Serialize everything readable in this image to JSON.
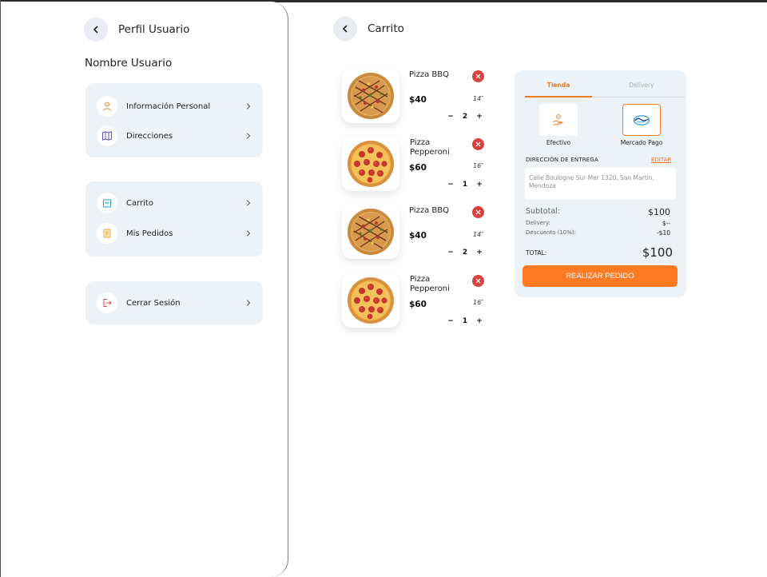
{
  "profile": {
    "title": "Perfil Usuario",
    "user_name": "Nombre Usuario",
    "group1": [
      {
        "label": "Información Personal",
        "icon": "user-icon"
      },
      {
        "label": "Direcciones",
        "icon": "map-icon"
      }
    ],
    "group2": [
      {
        "label": "Carrito",
        "icon": "shopping-bag-icon"
      },
      {
        "label": "Mis Pedidos",
        "icon": "orders-icon"
      }
    ],
    "group3": [
      {
        "label": "Cerrar Sesión",
        "icon": "logout-icon"
      }
    ]
  },
  "cart": {
    "title": "Carrito",
    "items": [
      {
        "name": "Pizza BBQ",
        "price": "$40",
        "size": "14″",
        "qty": "2",
        "image": "pizza-bbq"
      },
      {
        "name": "Pizza Pepperoni",
        "price": "$60",
        "size": "16″",
        "qty": "1",
        "image": "pizza-pepperoni"
      },
      {
        "name": "Pizza BBQ",
        "price": "$40",
        "size": "14″",
        "qty": "2",
        "image": "pizza-bbq"
      },
      {
        "name": "Pizza Pepperoni",
        "price": "$60",
        "size": "16″",
        "qty": "1",
        "image": "pizza-pepperoni"
      }
    ],
    "minus": "−",
    "plus": "+"
  },
  "summary": {
    "tabs": [
      "Tienda",
      "Delivery"
    ],
    "payment_options": [
      {
        "label": "Efectivo",
        "icon": "cash-hand-icon",
        "selected": false
      },
      {
        "label": "Mercado Pago",
        "icon": "mercado-pago-icon",
        "selected": true
      }
    ],
    "address_label": "DIRECCIÓN DE ENTREGA",
    "edit_label": "EDITAR",
    "address": "Calle Boulogne Sur Mer 1320, San Martín, Mendoza",
    "subtotal_label": "Subtotal:",
    "subtotal_value": "$100",
    "delivery_label": "Delivery:",
    "delivery_value": "$--",
    "discount_label": "Descuento (10%):",
    "discount_value": "-$10",
    "total_label": "TOTAL:",
    "total_value": "$100",
    "order_button": "REALIZAR PEDIDO"
  },
  "colors": {
    "accent": "#ff7a22",
    "card_bg": "#edf2f7",
    "remove": "#d9413c"
  }
}
